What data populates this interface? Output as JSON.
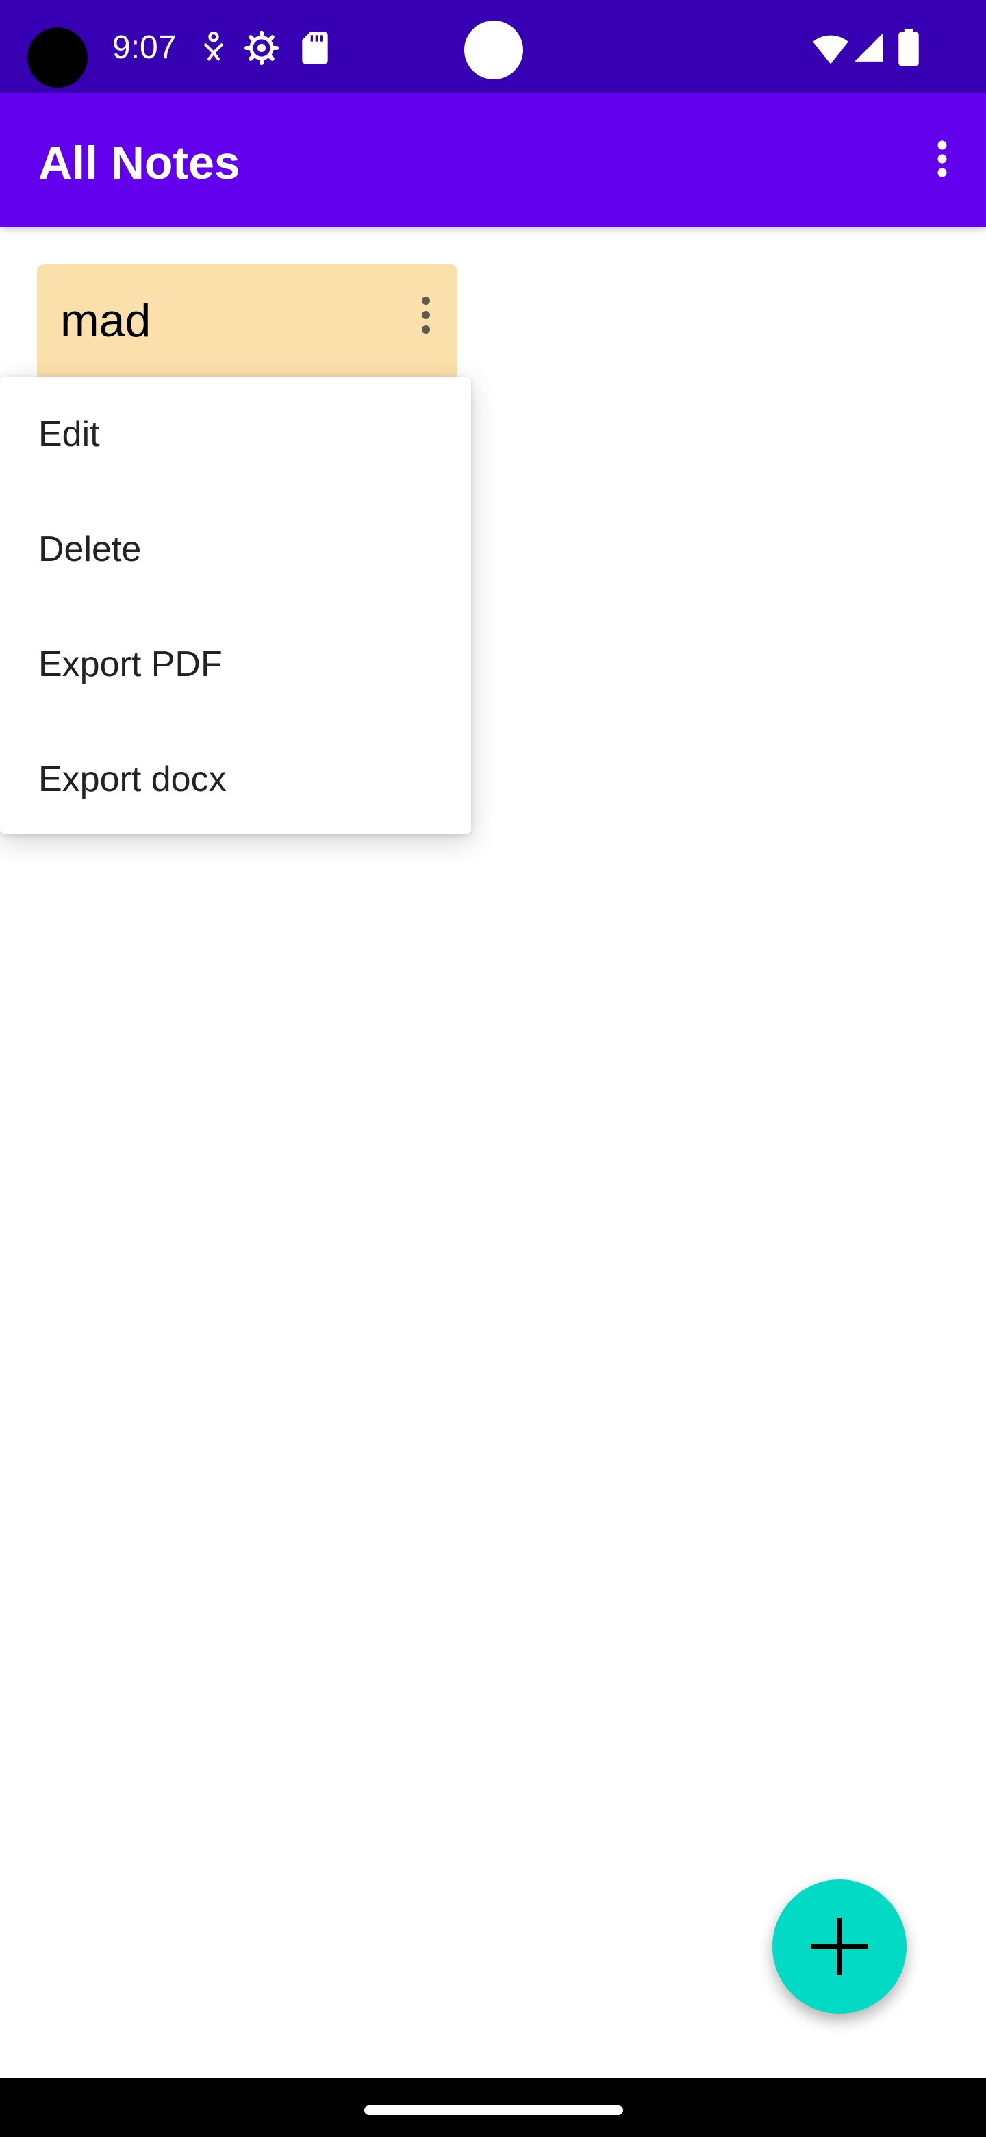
{
  "status_bar": {
    "time": "9:07",
    "icons": [
      "camera-hole",
      "accessibility-icon",
      "settings-gear-icon",
      "sd-card-icon",
      "wifi-icon",
      "cell-signal-icon",
      "battery-icon"
    ],
    "background_color": "#3700b3"
  },
  "app_bar": {
    "title": "All Notes",
    "overflow_icon": "more-vertical-icon",
    "background_color": "#6200ee"
  },
  "notes": [
    {
      "title": "mad",
      "color": "#fce0ac",
      "menu_icon": "more-vertical-icon"
    }
  ],
  "popup_menu": {
    "items": [
      {
        "label": "Edit"
      },
      {
        "label": "Delete"
      },
      {
        "label": "Export PDF"
      },
      {
        "label": "Export docx"
      }
    ]
  },
  "fab": {
    "icon": "plus-icon",
    "color": "#03dac5"
  },
  "nav_bar": {
    "icon": "home-pill"
  }
}
